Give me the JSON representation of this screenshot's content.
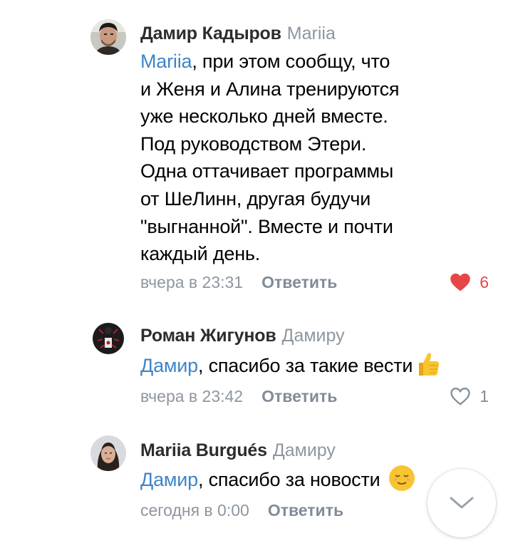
{
  "comments": [
    {
      "author": "Дамир Кадыров",
      "reply_to": "Mariia",
      "mention": "Mariia",
      "text": ", при этом сообщу, что\nи Женя и Алина тренируются\nуже несколько дней вместе.\nПод руководством Этери.\nОдна оттачивает программы\nот ШеЛинн, другая будучи\n\"выгнанной\". Вместе и почти\nкаждый день.",
      "time": "вчера в 23:31",
      "reply_label": "Ответить",
      "like_count": "6",
      "liked": true
    },
    {
      "author": "Роман Жигунов",
      "reply_to": "Дамиру",
      "mention": "Дамир",
      "text": ", спасибо за такие вести",
      "emoji": "thumbs-up",
      "time": "вчера в 23:42",
      "reply_label": "Ответить",
      "like_count": "1",
      "liked": false
    },
    {
      "author": "Mariia Burgués",
      "reply_to": "Дамиру",
      "mention": "Дамир",
      "text": ", спасибо за новости",
      "emoji": "relieved-face",
      "time": "сегодня в 0:00",
      "reply_label": "Ответить"
    }
  ],
  "colors": {
    "link": "#3f84c6",
    "secondary": "#818c99",
    "like_active": "#e64646"
  },
  "icons": {
    "like_active": "heart-filled-icon",
    "like_idle": "heart-outline-icon",
    "scroll_down": "chevron-down-icon"
  }
}
